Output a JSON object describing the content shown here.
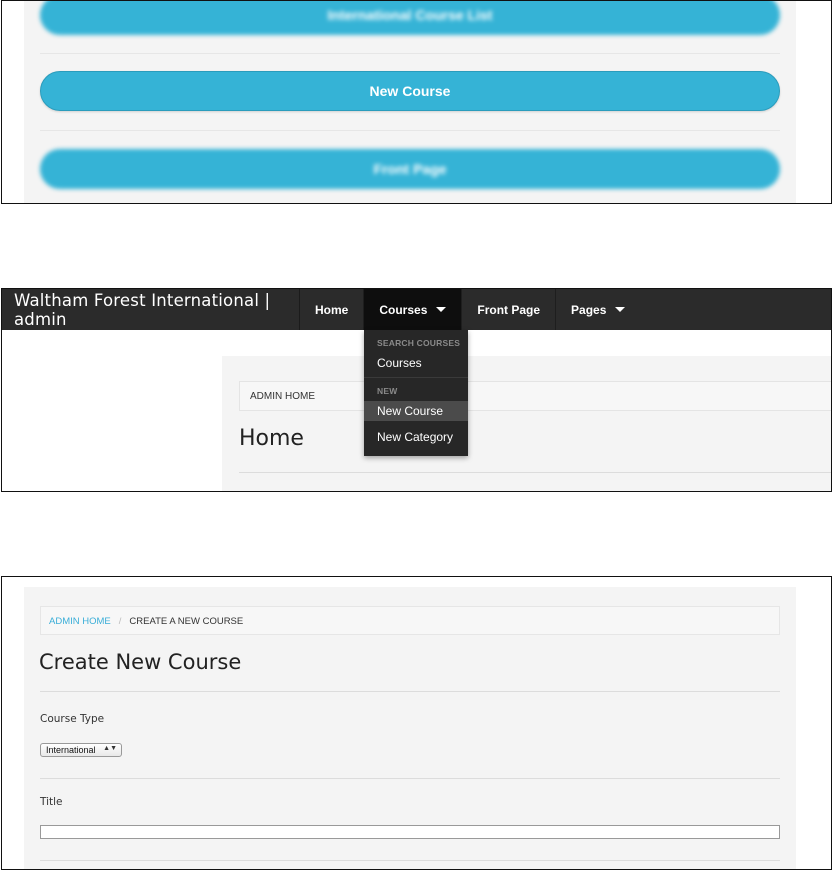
{
  "panel1": {
    "buttons": [
      {
        "label": "International Course List"
      },
      {
        "label": "New Course"
      },
      {
        "label": "Front Page"
      }
    ]
  },
  "panel2": {
    "brand": "Waltham Forest International | admin",
    "nav": {
      "home": "Home",
      "courses": "Courses",
      "front_page": "Front Page",
      "pages": "Pages"
    },
    "dropdown": {
      "header_search": "SEARCH COURSES",
      "item_courses": "Courses",
      "header_new": "NEW",
      "item_new_course": "New Course",
      "item_new_category": "New Category"
    },
    "breadcrumb": "ADMIN HOME",
    "title": "Home"
  },
  "panel3": {
    "breadcrumb": {
      "link": "ADMIN HOME",
      "separator": "/",
      "current": "CREATE A NEW COURSE"
    },
    "title": "Create New Course",
    "course_type_label": "Course Type",
    "course_type_value": "International",
    "select_arrows": "▲▼",
    "title_label": "Title",
    "title_value": ""
  },
  "colors": {
    "accent": "#35b3d6",
    "navbar": "#2b2b2b",
    "link": "#3aaed8"
  }
}
